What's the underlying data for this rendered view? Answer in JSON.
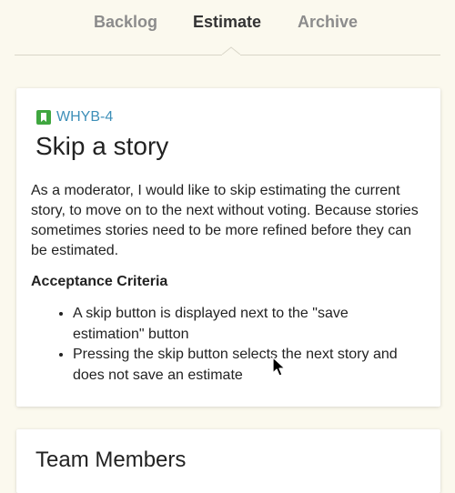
{
  "tabs": [
    {
      "label": "Backlog",
      "active": false
    },
    {
      "label": "Estimate",
      "active": true
    },
    {
      "label": "Archive",
      "active": false
    }
  ],
  "story": {
    "key": "WHYB-4",
    "key_icon": "bookmark-icon",
    "title": "Skip a story",
    "description": "As a moderator, I would like to skip estimating the current story, to move on to the next without voting. Because stories sometimes stories need to be more refined before they can be estimated.",
    "criteria_heading": "Acceptance Criteria",
    "criteria": [
      "A skip button is displayed next to the \"save estimation\" button",
      "Pressing the skip button selects the next story and does not save an estimate"
    ]
  },
  "members": {
    "title": "Team Members"
  },
  "colors": {
    "background": "#fbf9ee",
    "card": "#ffffff",
    "link": "#3d8fb8",
    "story_icon": "#3fa63f",
    "tab_inactive": "#8c8c8c",
    "tab_active": "#333333"
  }
}
